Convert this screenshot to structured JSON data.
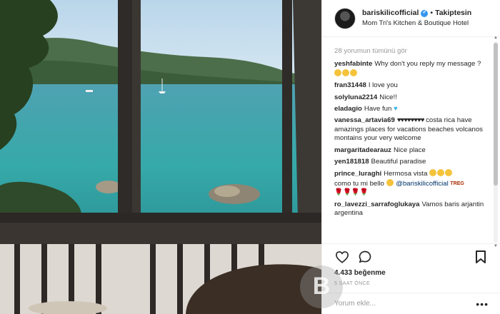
{
  "header": {
    "username": "bariskilicofficial",
    "verified_mark": "✔",
    "separator": "•",
    "follow_label": "Takiptesin",
    "location": "Mom Tri's Kitchen & Boutique Hotel"
  },
  "comments": {
    "load_more": "28 yorumun tümünü gör",
    "items": [
      {
        "user": "yeshfabinte",
        "text": "Why don't you reply my message ?"
      },
      {
        "user": "fran31448",
        "text": "I love you"
      },
      {
        "user": "solyluna2214",
        "text": "Nice!!"
      },
      {
        "user": "eladagio",
        "text": "Have fun"
      },
      {
        "user": "vanessa_artavia69",
        "hearts": "♥♥♥♥♥♥♥♥",
        "text": "costa rica have amazings places for vacations beaches volcanos montains your very welcome"
      },
      {
        "user": "margaritadearauz",
        "text": "Nice place"
      },
      {
        "user": "yen181818",
        "text": "Beautiful paradise"
      },
      {
        "user": "prince_luraghi",
        "text": "Hermosa vista",
        "text2": "como tu mi bello",
        "mention": "@bariskilicofficial",
        "tag": "TREG",
        "roses": "🌹🌹🌹🌹"
      },
      {
        "user": "ro_lavezzi_sarrafoglukaya",
        "text": "Vamos baris arjantin argentina"
      }
    ]
  },
  "actions": {
    "like_icon": "heart-outline-icon",
    "comment_icon": "speech-bubble-icon",
    "save_icon": "bookmark-icon",
    "likes_text": "4.433 beğenme",
    "time_ago": "5 saat önce"
  },
  "add_comment": {
    "placeholder": "Yorum ekle...",
    "more": "•••"
  },
  "watermark": {
    "letter": "B"
  },
  "colors": {
    "accent_blue": "#3897f0",
    "text": "#262626",
    "muted": "#999999",
    "border": "#efefef"
  }
}
